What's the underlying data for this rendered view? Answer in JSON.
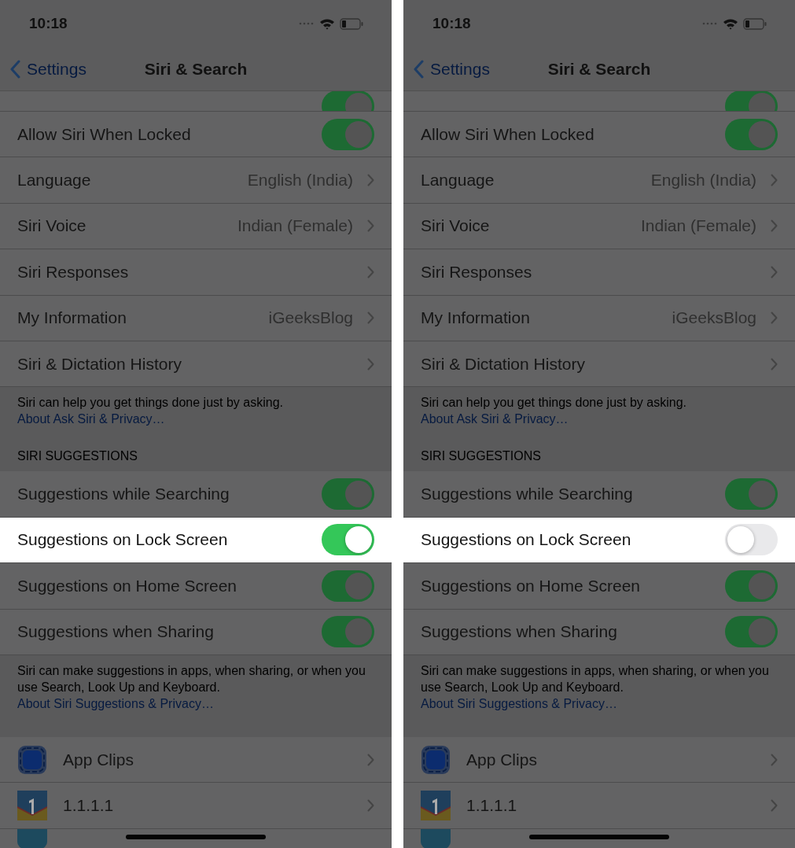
{
  "panels": [
    {
      "status": {
        "time": "10:18"
      },
      "nav": {
        "back": "Settings",
        "title": "Siri & Search"
      },
      "sections": [
        {
          "rows": [
            {
              "kind": "toggle",
              "on": true,
              "highlighted": false
            },
            {
              "kind": "toggle",
              "label": "Allow Siri When Locked",
              "on": true,
              "highlighted": false
            },
            {
              "kind": "detail",
              "label": "Language",
              "value": "English (India)",
              "highlighted": false
            },
            {
              "kind": "detail",
              "label": "Siri Voice",
              "value": "Indian (Female)",
              "highlighted": false
            },
            {
              "kind": "detail",
              "label": "Siri Responses",
              "highlighted": false
            },
            {
              "kind": "detail",
              "label": "My Information",
              "value": "iGeeksBlog",
              "highlighted": false
            },
            {
              "kind": "detail",
              "label": "Siri & Dictation History",
              "highlighted": false
            }
          ],
          "footer": {
            "text": "Siri can help you get things done just by asking.",
            "link": "About Ask Siri & Privacy…"
          }
        },
        {
          "header": "SIRI SUGGESTIONS",
          "rows": [
            {
              "kind": "toggle",
              "label": "Suggestions while Searching",
              "on": true,
              "highlighted": false
            },
            {
              "kind": "toggle",
              "label": "Suggestions on Lock Screen",
              "on": true,
              "highlighted": true
            },
            {
              "kind": "toggle",
              "label": "Suggestions on Home Screen",
              "on": true,
              "highlighted": false
            },
            {
              "kind": "toggle",
              "label": "Suggestions when Sharing",
              "on": true,
              "highlighted": false
            }
          ],
          "footer": {
            "text": "Siri can make suggestions in apps, when sharing, or when you use Search, Look Up and Keyboard.",
            "link": "About Siri Suggestions & Privacy…"
          }
        },
        {
          "rows": [
            {
              "kind": "app",
              "label": "App Clips",
              "highlighted": false
            },
            {
              "kind": "app",
              "label": "1.1.1.1",
              "highlighted": false
            },
            {
              "kind": "app",
              "highlighted": false
            }
          ]
        }
      ]
    },
    {
      "status": {
        "time": "10:18"
      },
      "nav": {
        "back": "Settings",
        "title": "Siri & Search"
      },
      "sections": [
        {
          "rows": [
            {
              "kind": "toggle",
              "on": true,
              "highlighted": false
            },
            {
              "kind": "toggle",
              "label": "Allow Siri When Locked",
              "on": true,
              "highlighted": false
            },
            {
              "kind": "detail",
              "label": "Language",
              "value": "English (India)",
              "highlighted": false
            },
            {
              "kind": "detail",
              "label": "Siri Voice",
              "value": "Indian (Female)",
              "highlighted": false
            },
            {
              "kind": "detail",
              "label": "Siri Responses",
              "highlighted": false
            },
            {
              "kind": "detail",
              "label": "My Information",
              "value": "iGeeksBlog",
              "highlighted": false
            },
            {
              "kind": "detail",
              "label": "Siri & Dictation History",
              "highlighted": false
            }
          ],
          "footer": {
            "text": "Siri can help you get things done just by asking.",
            "link": "About Ask Siri & Privacy…"
          }
        },
        {
          "header": "SIRI SUGGESTIONS",
          "rows": [
            {
              "kind": "toggle",
              "label": "Suggestions while Searching",
              "on": true,
              "highlighted": false
            },
            {
              "kind": "toggle",
              "label": "Suggestions on Lock Screen",
              "on": false,
              "highlighted": true
            },
            {
              "kind": "toggle",
              "label": "Suggestions on Home Screen",
              "on": true,
              "highlighted": false
            },
            {
              "kind": "toggle",
              "label": "Suggestions when Sharing",
              "on": true,
              "highlighted": false
            }
          ],
          "footer": {
            "text": "Siri can make suggestions in apps, when sharing, or when you use Search, Look Up and Keyboard.",
            "link": "About Siri Suggestions & Privacy…"
          }
        },
        {
          "rows": [
            {
              "kind": "app",
              "label": "App Clips",
              "highlighted": false
            },
            {
              "kind": "app",
              "label": "1.1.1.1",
              "highlighted": false
            },
            {
              "kind": "app",
              "highlighted": false
            }
          ]
        }
      ]
    }
  ]
}
